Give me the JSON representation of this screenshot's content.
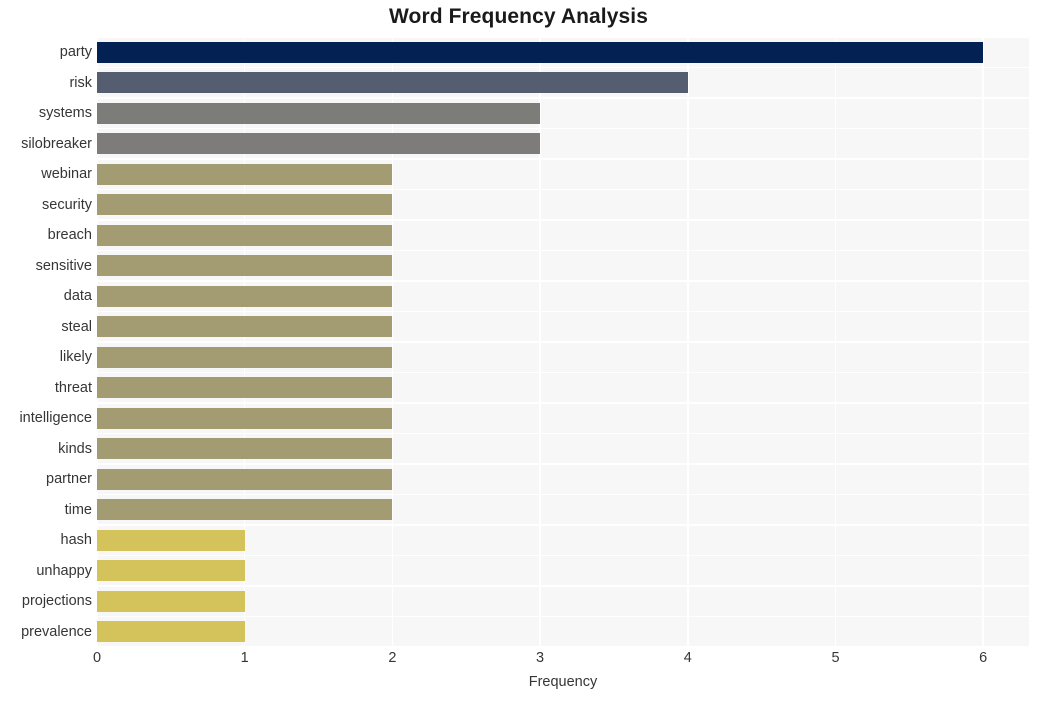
{
  "chart_data": {
    "type": "bar",
    "orientation": "horizontal",
    "title": "Word Frequency Analysis",
    "xlabel": "Frequency",
    "ylabel": "",
    "xlim": [
      0,
      6.31
    ],
    "xticks": [
      "0",
      "1",
      "2",
      "3",
      "4",
      "5",
      "6"
    ],
    "xtick_values": [
      0,
      1,
      2,
      3,
      4,
      5,
      6
    ],
    "grid": true,
    "legend": "none",
    "categories": [
      "party",
      "risk",
      "systems",
      "silobreaker",
      "webinar",
      "security",
      "breach",
      "sensitive",
      "data",
      "steal",
      "likely",
      "threat",
      "intelligence",
      "kinds",
      "partner",
      "time",
      "hash",
      "unhappy",
      "projections",
      "prevalence"
    ],
    "values": [
      6,
      4,
      3,
      3,
      2,
      2,
      2,
      2,
      2,
      2,
      2,
      2,
      2,
      2,
      2,
      2,
      1,
      1,
      1,
      1
    ],
    "bar_colors": [
      "#032253",
      "#555d70",
      "#7c7c78",
      "#7d7c7a",
      "#a39b72",
      "#a39b72",
      "#a39b72",
      "#a39b72",
      "#a39b72",
      "#a39b72",
      "#a39b72",
      "#a39b72",
      "#a39b72",
      "#a39b72",
      "#a39b72",
      "#a39b72",
      "#d4c35a",
      "#d4c35a",
      "#d4c35a",
      "#d4c35a"
    ]
  },
  "style": {
    "plot_background": "#f7f7f7",
    "figure_background": "#ffffff",
    "grid_color": "#ffffff",
    "text_color": "#363636",
    "title_color": "#1a1a1a"
  }
}
